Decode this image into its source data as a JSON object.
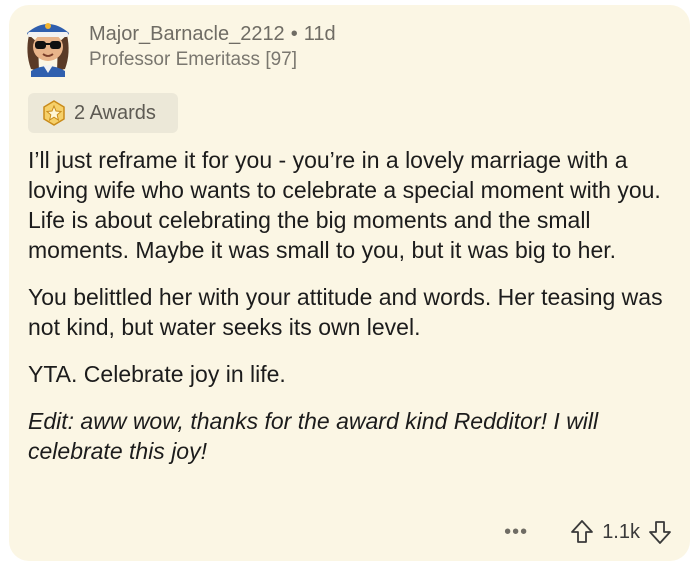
{
  "comment": {
    "username": "Major_Barnacle_2212",
    "separator": "•",
    "age": "11d",
    "flair": "Professor Emeritass [97]",
    "awards_label": "2 Awards",
    "paragraphs": [
      "I’ll just reframe it for you - you’re in a lovely marriage with a loving wife who wants to celebrate a special moment with you. Life is about celebrating the big moments and the small moments. Maybe it was small to you, but it was big to her.",
      "You belittled her with your attitude and words. Her teasing was not kind, but water seeks its own level.",
      "YTA. Celebrate joy in life."
    ],
    "edit_text": "Edit: aww wow, thanks for the award kind Redditor! I will celebrate this joy!",
    "more_label": "•••",
    "score": "1.1k"
  },
  "icons": {
    "avatar": "snoo-avatar-sailor-cap",
    "award": "award-star-icon",
    "more": "more-options-icon",
    "upvote": "upvote-arrow-icon",
    "downvote": "downvote-arrow-icon"
  },
  "colors": {
    "card_background": "#fbf6e4",
    "awards_background": "#ece8d8",
    "award_gold": "#f2b530",
    "meta_text": "#6f6c64"
  }
}
